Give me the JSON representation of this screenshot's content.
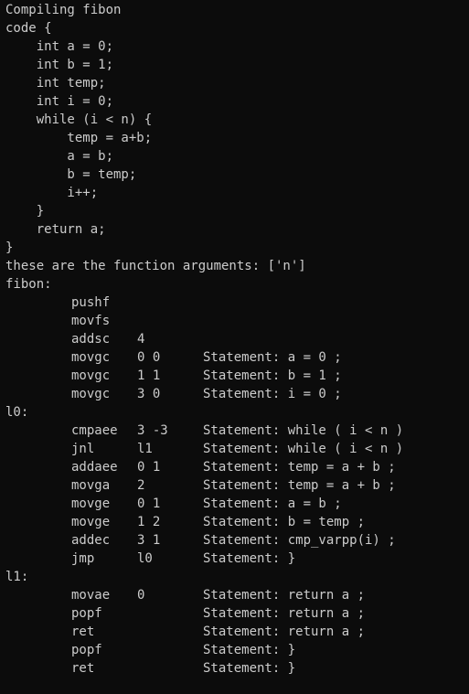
{
  "header_lines": [
    "Compiling fibon",
    "code {",
    "    int a = 0;",
    "    int b = 1;",
    "    int temp;",
    "    int i = 0;",
    "    while (i < n) {",
    "        temp = a+b;",
    "        a = b;",
    "        b = temp;",
    "        i++;",
    "    }",
    "    return a;",
    "}",
    "these are the function arguments: ['n']",
    "fibon:"
  ],
  "block_fibon": [
    {
      "op": "pushf",
      "args": "",
      "stmt": ""
    },
    {
      "op": "movfs",
      "args": "",
      "stmt": ""
    },
    {
      "op": "addsc",
      "args": "4",
      "stmt": ""
    },
    {
      "op": "movgc",
      "args": "0 0",
      "stmt": "Statement: a = 0 ;"
    },
    {
      "op": "movgc",
      "args": "1 1",
      "stmt": "Statement: b = 1 ;"
    },
    {
      "op": "movgc",
      "args": "3 0",
      "stmt": "Statement: i = 0 ;"
    }
  ],
  "label_l0": "l0:",
  "block_l0": [
    {
      "op": "cmpaee",
      "args": "3 -3",
      "stmt": "Statement: while ( i < n )"
    },
    {
      "op": "jnl",
      "args": "l1",
      "stmt": "Statement: while ( i < n )"
    },
    {
      "op": "addaee",
      "args": "0 1",
      "stmt": "Statement: temp = a + b ;"
    },
    {
      "op": "movga",
      "args": "2",
      "stmt": "Statement: temp = a + b ;"
    },
    {
      "op": "movge",
      "args": "0 1",
      "stmt": "Statement: a = b ;"
    },
    {
      "op": "movge",
      "args": "1 2",
      "stmt": "Statement: b = temp ;"
    },
    {
      "op": "addec",
      "args": "3 1",
      "stmt": "Statement: cmp_varpp(i) ;"
    },
    {
      "op": "jmp",
      "args": "l0",
      "stmt": "Statement: }"
    }
  ],
  "label_l1": "l1:",
  "block_l1": [
    {
      "op": "movae",
      "args": "0",
      "stmt": "Statement: return a ;"
    },
    {
      "op": "popf",
      "args": "",
      "stmt": "Statement: return a ;"
    },
    {
      "op": "ret",
      "args": "",
      "stmt": "Statement: return a ;"
    },
    {
      "op": "popf",
      "args": "",
      "stmt": "Statement: }"
    },
    {
      "op": "ret",
      "args": "",
      "stmt": "Statement: }"
    }
  ]
}
